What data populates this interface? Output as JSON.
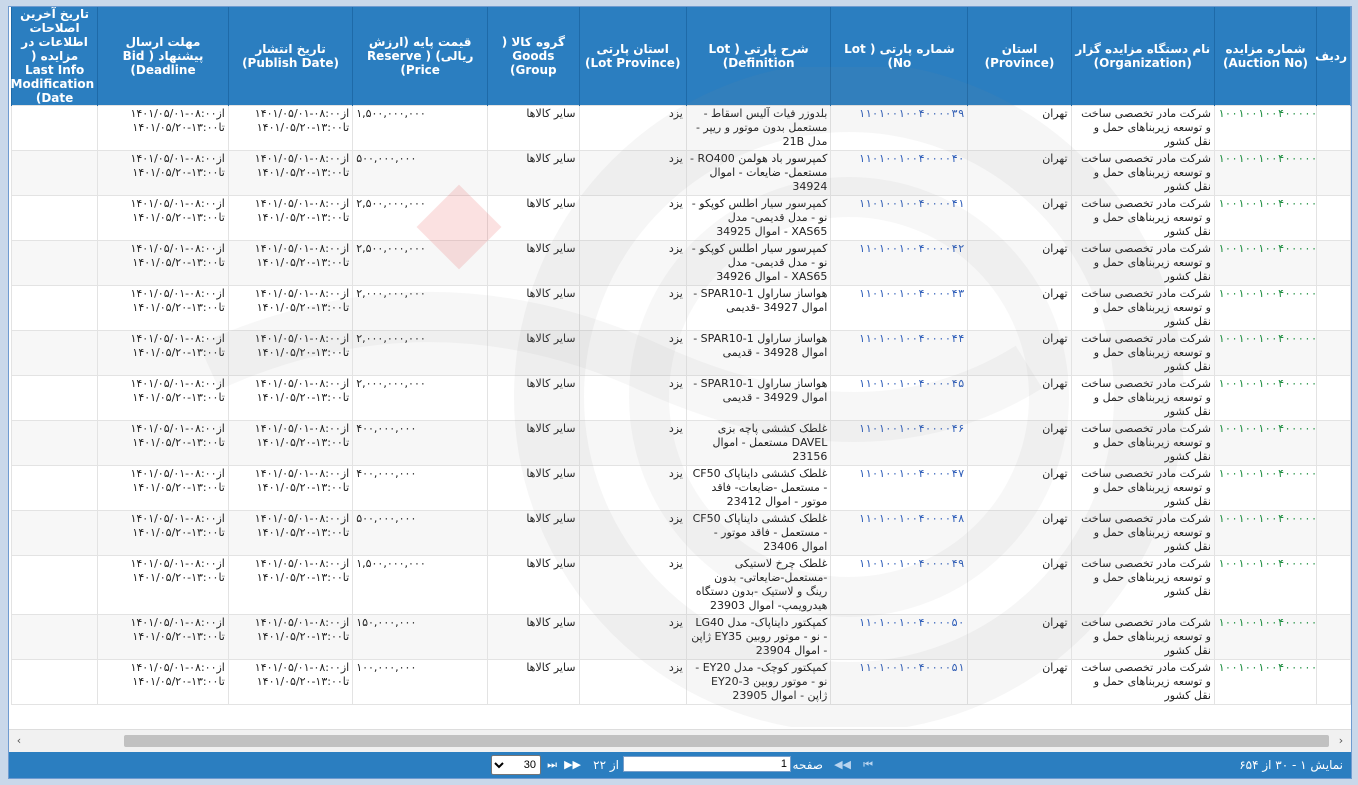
{
  "columns": [
    {
      "key": "row",
      "label": "ردیف"
    },
    {
      "key": "auction_no",
      "label": "شماره مزایده (Auction No)"
    },
    {
      "key": "organization",
      "label": "نام دستگاه مزایده گزار (Organization)"
    },
    {
      "key": "province",
      "label": "استان (Province)"
    },
    {
      "key": "lot_no",
      "label": "شماره پارتی ( Lot No)"
    },
    {
      "key": "definition",
      "label": "شرح پارتی ( Lot Definition)"
    },
    {
      "key": "lot_province",
      "label": "استان پارتی (Lot Province)"
    },
    {
      "key": "goods_group",
      "label": "گروه کالا ( Goods Group)"
    },
    {
      "key": "reserve_price",
      "label": "قیمت پایه (ارزش ریالی) ( Reserve Price)"
    },
    {
      "key": "publish_date",
      "label": "تاریخ انتشار (Publish Date)"
    },
    {
      "key": "deadline",
      "label": "مهلت ارسال پیشنهاد ( Bid Deadline)"
    },
    {
      "key": "last_mod",
      "label": "تاریخ آخرین اصلاحات اطلاعات در مزایده ( Last Info Modification Date)"
    }
  ],
  "rows": [
    {
      "auction_no": "۱۰۰۱۰۰۱۰۰۴۰۰۰۰۰۵",
      "organization": "شرکت مادر تخصصی ساخت و توسعه زیربناهای حمل و نقل کشور",
      "province": "تهران",
      "lot_no": "۱۱۰۱۰۰۱۰۰۴۰۰۰۰۳۹",
      "definition": "بلدوزر فیات آلیس اسقاط - مستعمل بدون موتور و ریپر - مدل 21B",
      "lot_province": "یزد",
      "goods_group": "سایر کالاها",
      "reserve_price": "۱,۵۰۰,۰۰۰,۰۰۰",
      "publish_from": "از۰۸:۰۰-۱۴۰۱/۰۵/۰۱",
      "publish_to": "تا۱۳:۰۰-۱۴۰۱/۰۵/۲۰",
      "deadline_from": "از۰۸:۰۰-۱۴۰۱/۰۵/۰۱",
      "deadline_to": "تا۱۳:۰۰-۱۴۰۱/۰۵/۲۰"
    },
    {
      "auction_no": "۱۰۰۱۰۰۱۰۰۴۰۰۰۰۰۵",
      "organization": "شرکت مادر تخصصی ساخت و توسعه زیربناهای حمل و نقل کشور",
      "province": "تهران",
      "lot_no": "۱۱۰۱۰۰۱۰۰۴۰۰۰۰۴۰",
      "definition": "کمپرسور باد هولمن RO400 - مستعمل- ضایعات - اموال 34924",
      "lot_province": "یزد",
      "goods_group": "سایر کالاها",
      "reserve_price": "۵۰۰,۰۰۰,۰۰۰",
      "publish_from": "از۰۸:۰۰-۱۴۰۱/۰۵/۰۱",
      "publish_to": "تا۱۳:۰۰-۱۴۰۱/۰۵/۲۰",
      "deadline_from": "از۰۸:۰۰-۱۴۰۱/۰۵/۰۱",
      "deadline_to": "تا۱۳:۰۰-۱۴۰۱/۰۵/۲۰"
    },
    {
      "auction_no": "۱۰۰۱۰۰۱۰۰۴۰۰۰۰۰۵",
      "organization": "شرکت مادر تخصصی ساخت و توسعه زیربناهای حمل و نقل کشور",
      "province": "تهران",
      "lot_no": "۱۱۰۱۰۰۱۰۰۴۰۰۰۰۴۱",
      "definition": "کمپرسور سیار اطلس کوپکو - نو - مدل قدیمی- مدل XAS65 - اموال 34925",
      "lot_province": "یزد",
      "goods_group": "سایر کالاها",
      "reserve_price": "۲,۵۰۰,۰۰۰,۰۰۰",
      "publish_from": "از۰۸:۰۰-۱۴۰۱/۰۵/۰۱",
      "publish_to": "تا۱۳:۰۰-۱۴۰۱/۰۵/۲۰",
      "deadline_from": "از۰۸:۰۰-۱۴۰۱/۰۵/۰۱",
      "deadline_to": "تا۱۳:۰۰-۱۴۰۱/۰۵/۲۰"
    },
    {
      "auction_no": "۱۰۰۱۰۰۱۰۰۴۰۰۰۰۰۵",
      "organization": "شرکت مادر تخصصی ساخت و توسعه زیربناهای حمل و نقل کشور",
      "province": "تهران",
      "lot_no": "۱۱۰۱۰۰۱۰۰۴۰۰۰۰۴۲",
      "definition": "کمپرسور سیار اطلس کوپکو - نو - مدل قدیمی- مدل XAS65 - اموال 34926",
      "lot_province": "یزد",
      "goods_group": "سایر کالاها",
      "reserve_price": "۲,۵۰۰,۰۰۰,۰۰۰",
      "publish_from": "از۰۸:۰۰-۱۴۰۱/۰۵/۰۱",
      "publish_to": "تا۱۳:۰۰-۱۴۰۱/۰۵/۲۰",
      "deadline_from": "از۰۸:۰۰-۱۴۰۱/۰۵/۰۱",
      "deadline_to": "تا۱۳:۰۰-۱۴۰۱/۰۵/۲۰"
    },
    {
      "auction_no": "۱۰۰۱۰۰۱۰۰۴۰۰۰۰۰۵",
      "organization": "شرکت مادر تخصصی ساخت و توسعه زیربناهای حمل و نقل کشور",
      "province": "تهران",
      "lot_no": "۱۱۰۱۰۰۱۰۰۴۰۰۰۰۴۳",
      "definition": "هواساز ساراول SPAR10-1 - اموال 34927 -قدیمی",
      "lot_province": "یزد",
      "goods_group": "سایر کالاها",
      "reserve_price": "۲,۰۰۰,۰۰۰,۰۰۰",
      "publish_from": "از۰۸:۰۰-۱۴۰۱/۰۵/۰۱",
      "publish_to": "تا۱۳:۰۰-۱۴۰۱/۰۵/۲۰",
      "deadline_from": "از۰۸:۰۰-۱۴۰۱/۰۵/۰۱",
      "deadline_to": "تا۱۳:۰۰-۱۴۰۱/۰۵/۲۰"
    },
    {
      "auction_no": "۱۰۰۱۰۰۱۰۰۴۰۰۰۰۰۵",
      "organization": "شرکت مادر تخصصی ساخت و توسعه زیربناهای حمل و نقل کشور",
      "province": "تهران",
      "lot_no": "۱۱۰۱۰۰۱۰۰۴۰۰۰۰۴۴",
      "definition": "هواساز ساراول SPAR10-1 - اموال 34928 - قدیمی",
      "lot_province": "یزد",
      "goods_group": "سایر کالاها",
      "reserve_price": "۲,۰۰۰,۰۰۰,۰۰۰",
      "publish_from": "از۰۸:۰۰-۱۴۰۱/۰۵/۰۱",
      "publish_to": "تا۱۳:۰۰-۱۴۰۱/۰۵/۲۰",
      "deadline_from": "از۰۸:۰۰-۱۴۰۱/۰۵/۰۱",
      "deadline_to": "تا۱۳:۰۰-۱۴۰۱/۰۵/۲۰"
    },
    {
      "auction_no": "۱۰۰۱۰۰۱۰۰۴۰۰۰۰۰۵",
      "organization": "شرکت مادر تخصصی ساخت و توسعه زیربناهای حمل و نقل کشور",
      "province": "تهران",
      "lot_no": "۱۱۰۱۰۰۱۰۰۴۰۰۰۰۴۵",
      "definition": "هواساز ساراول SPAR10-1 - اموال 34929 - قدیمی",
      "lot_province": "یزد",
      "goods_group": "سایر کالاها",
      "reserve_price": "۲,۰۰۰,۰۰۰,۰۰۰",
      "publish_from": "از۰۸:۰۰-۱۴۰۱/۰۵/۰۱",
      "publish_to": "تا۱۳:۰۰-۱۴۰۱/۰۵/۲۰",
      "deadline_from": "از۰۸:۰۰-۱۴۰۱/۰۵/۰۱",
      "deadline_to": "تا۱۳:۰۰-۱۴۰۱/۰۵/۲۰"
    },
    {
      "auction_no": "۱۰۰۱۰۰۱۰۰۴۰۰۰۰۰۵",
      "organization": "شرکت مادر تخصصی ساخت و توسعه زیربناهای حمل و نقل کشور",
      "province": "تهران",
      "lot_no": "۱۱۰۱۰۰۱۰۰۴۰۰۰۰۴۶",
      "definition": "غلطک کششی پاچه بزی DAVEL مستعمل - اموال 23156",
      "lot_province": "یزد",
      "goods_group": "سایر کالاها",
      "reserve_price": "۴۰۰,۰۰۰,۰۰۰",
      "publish_from": "از۰۸:۰۰-۱۴۰۱/۰۵/۰۱",
      "publish_to": "تا۱۳:۰۰-۱۴۰۱/۰۵/۲۰",
      "deadline_from": "از۰۸:۰۰-۱۴۰۱/۰۵/۰۱",
      "deadline_to": "تا۱۳:۰۰-۱۴۰۱/۰۵/۲۰"
    },
    {
      "auction_no": "۱۰۰۱۰۰۱۰۰۴۰۰۰۰۰۵",
      "organization": "شرکت مادر تخصصی ساخت و توسعه زیربناهای حمل و نقل کشور",
      "province": "تهران",
      "lot_no": "۱۱۰۱۰۰۱۰۰۴۰۰۰۰۴۷",
      "definition": "غلطک کششی دایناپاک CF50 - مستعمل -ضایعات- فاقد موتور - اموال 23412",
      "lot_province": "یزد",
      "goods_group": "سایر کالاها",
      "reserve_price": "۴۰۰,۰۰۰,۰۰۰",
      "publish_from": "از۰۸:۰۰-۱۴۰۱/۰۵/۰۱",
      "publish_to": "تا۱۳:۰۰-۱۴۰۱/۰۵/۲۰",
      "deadline_from": "از۰۸:۰۰-۱۴۰۱/۰۵/۰۱",
      "deadline_to": "تا۱۳:۰۰-۱۴۰۱/۰۵/۲۰"
    },
    {
      "auction_no": "۱۰۰۱۰۰۱۰۰۴۰۰۰۰۰۵",
      "organization": "شرکت مادر تخصصی ساخت و توسعه زیربناهای حمل و نقل کشور",
      "province": "تهران",
      "lot_no": "۱۱۰۱۰۰۱۰۰۴۰۰۰۰۴۸",
      "definition": "غلطک کششی دایناپاک CF50 - مستعمل - فاقد موتور - اموال 23406",
      "lot_province": "یزد",
      "goods_group": "سایر کالاها",
      "reserve_price": "۵۰۰,۰۰۰,۰۰۰",
      "publish_from": "از۰۸:۰۰-۱۴۰۱/۰۵/۰۱",
      "publish_to": "تا۱۳:۰۰-۱۴۰۱/۰۵/۲۰",
      "deadline_from": "از۰۸:۰۰-۱۴۰۱/۰۵/۰۱",
      "deadline_to": "تا۱۳:۰۰-۱۴۰۱/۰۵/۲۰"
    },
    {
      "auction_no": "۱۰۰۱۰۰۱۰۰۴۰۰۰۰۰۵",
      "organization": "شرکت مادر تخصصی ساخت و توسعه زیربناهای حمل و نقل کشور",
      "province": "تهران",
      "lot_no": "۱۱۰۱۰۰۱۰۰۴۰۰۰۰۴۹",
      "definition": "غلطک چرخ لاستیکی -مستعمل-ضایعاتی- بدون رینگ و لاستیک -بدون دستگاه هیدرویمپ- اموال 23903",
      "lot_province": "یزد",
      "goods_group": "سایر کالاها",
      "reserve_price": "۱,۵۰۰,۰۰۰,۰۰۰",
      "publish_from": "از۰۸:۰۰-۱۴۰۱/۰۵/۰۱",
      "publish_to": "تا۱۳:۰۰-۱۴۰۱/۰۵/۲۰",
      "deadline_from": "از۰۸:۰۰-۱۴۰۱/۰۵/۰۱",
      "deadline_to": "تا۱۳:۰۰-۱۴۰۱/۰۵/۲۰"
    },
    {
      "auction_no": "۱۰۰۱۰۰۱۰۰۴۰۰۰۰۰۵",
      "organization": "شرکت مادر تخصصی ساخت و توسعه زیربناهای حمل و نقل کشور",
      "province": "تهران",
      "lot_no": "۱۱۰۱۰۰۱۰۰۴۰۰۰۰۵۰",
      "definition": "کمپکتور دایناپاک- مدل LG40 - نو - موتور روبین EY35 ژاپن - اموال 23904",
      "lot_province": "یزد",
      "goods_group": "سایر کالاها",
      "reserve_price": "۱۵۰,۰۰۰,۰۰۰",
      "publish_from": "از۰۸:۰۰-۱۴۰۱/۰۵/۰۱",
      "publish_to": "تا۱۳:۰۰-۱۴۰۱/۰۵/۲۰",
      "deadline_from": "از۰۸:۰۰-۱۴۰۱/۰۵/۰۱",
      "deadline_to": "تا۱۳:۰۰-۱۴۰۱/۰۵/۲۰"
    },
    {
      "auction_no": "۱۰۰۱۰۰۱۰۰۴۰۰۰۰۰۵",
      "organization": "شرکت مادر تخصصی ساخت و توسعه زیربناهای حمل و نقل کشور",
      "province": "تهران",
      "lot_no": "۱۱۰۱۰۰۱۰۰۴۰۰۰۰۵۱",
      "definition": "کمپکتور کوچک- مدل EY20 - نو - موتور روبین EY20-3 ژاپن - اموال 23905",
      "lot_province": "یزد",
      "goods_group": "سایر کالاها",
      "reserve_price": "۱۰۰,۰۰۰,۰۰۰",
      "publish_from": "از۰۸:۰۰-۱۴۰۱/۰۵/۰۱",
      "publish_to": "تا۱۳:۰۰-۱۴۰۱/۰۵/۲۰",
      "deadline_from": "از۰۸:۰۰-۱۴۰۱/۰۵/۰۱",
      "deadline_to": "تا۱۳:۰۰-۱۴۰۱/۰۵/۲۰"
    }
  ],
  "pager": {
    "status": "نمایش ۱ - ۳۰ از ۶۵۴",
    "page_label": "صفحه",
    "page_value": "1",
    "of_label": "از ۲۲",
    "page_size": "30",
    "first": "⏮",
    "prev": "◀◀",
    "next": "▶▶",
    "last": "⏭"
  },
  "scroll": {
    "left": "‹",
    "right": "›"
  },
  "colors": {
    "header": "#2b7ec0",
    "link": "#168a3a",
    "lot": "#2b5bb8"
  }
}
